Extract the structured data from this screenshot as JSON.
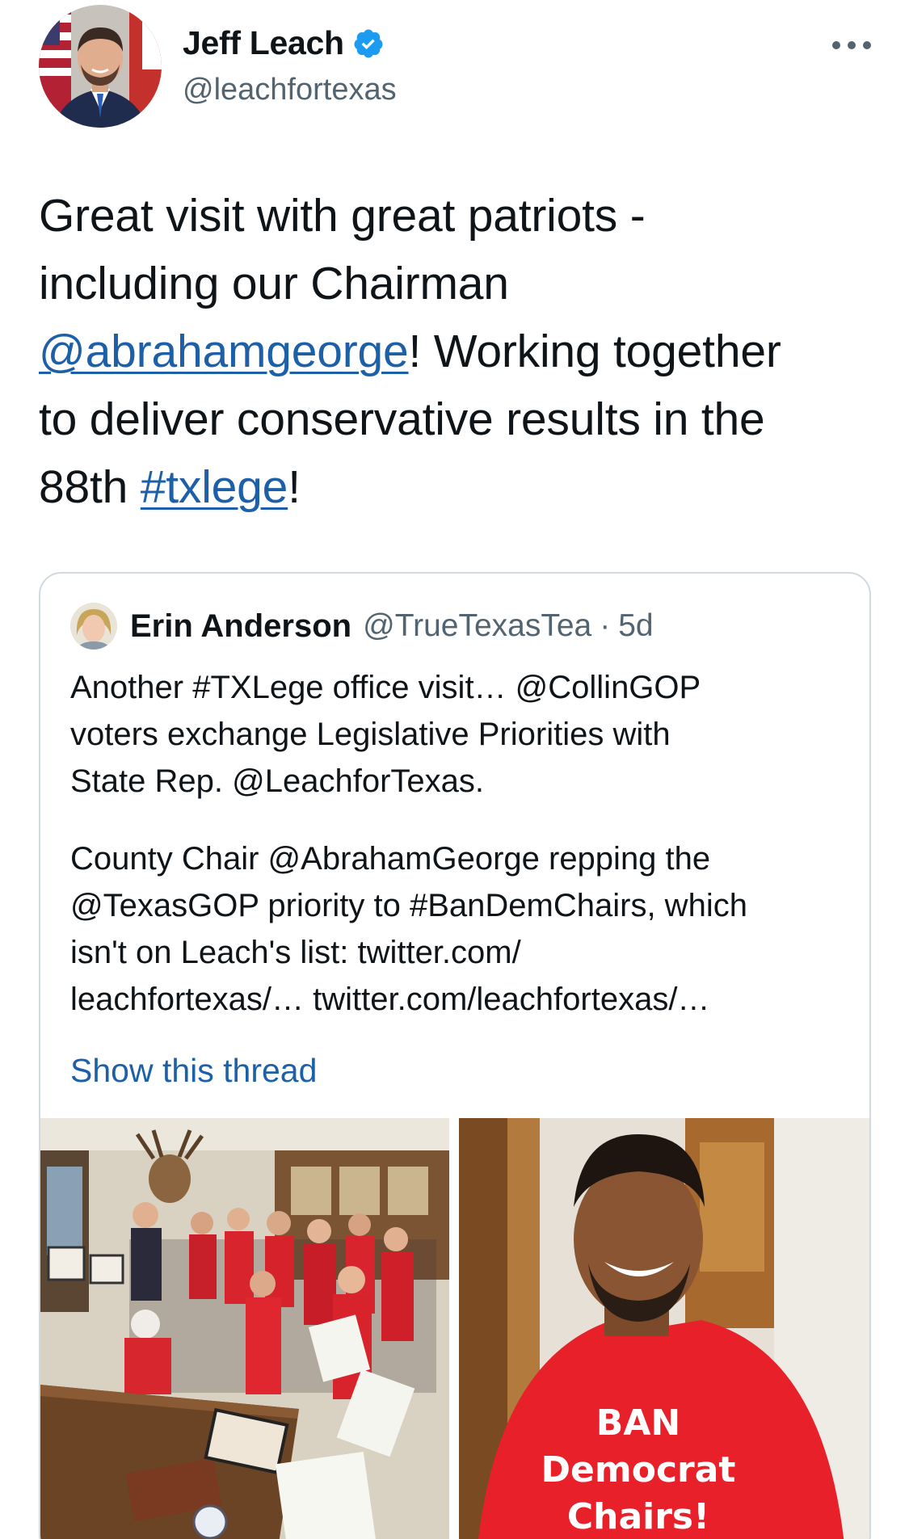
{
  "author": {
    "display_name": "Jeff Leach",
    "handle": "@leachfortexas",
    "verified": true
  },
  "tweet": {
    "line1": "Great visit with great patriots -",
    "line2": "including our Chairman",
    "mention": "@abrahamgeorge",
    "line3_rest": "! Working together",
    "line4": "to deliver conservative results in the",
    "line5_pre": "88th ",
    "hashtag": "#txlege",
    "line5_post": "!"
  },
  "quoted": {
    "display_name": "Erin Anderson",
    "handle": "@TrueTexasTea",
    "separator": "·",
    "time": "5d",
    "para1": "Another #TXLege office visit… @CollinGOP\nvoters exchange Legislative Priorities with\nState Rep. @LeachforTexas.",
    "para2": "County Chair @AbrahamGeorge repping the\n@TexasGOP priority to #BanDemChairs, which\nisn't on Leach's list: twitter.com/\nleachfortexas/… twitter.com/leachfortexas/…",
    "show_thread": "Show this thread",
    "shirt_text": [
      "BAN",
      "Democrat",
      "Chairs!"
    ]
  },
  "colors": {
    "link": "#1d60a8",
    "verified": "#1d9bf0",
    "muted": "#536471",
    "border": "#cfd9de",
    "shirt_red": "#e8202a"
  },
  "icons": {
    "verified": "verified-badge-icon",
    "more": "more-options-icon"
  }
}
